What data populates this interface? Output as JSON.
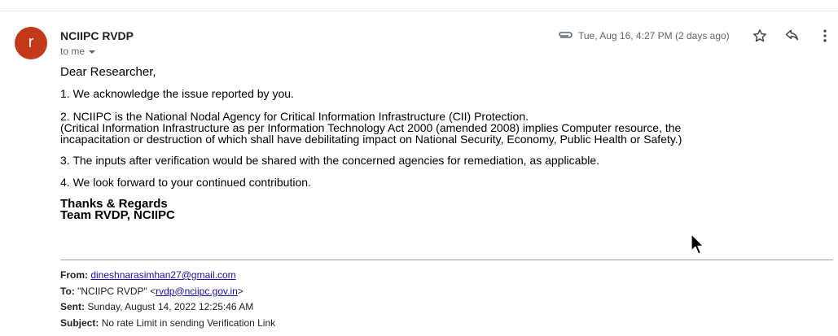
{
  "email": {
    "avatar_letter": "r",
    "avatar_color": "#c5391b",
    "sender": "NCIIPC RVDP",
    "to_me": "to me",
    "date": "Tue, Aug 16, 4:27 PM (2 days ago)",
    "icons": [
      "paperclip-icon",
      "star-icon",
      "reply-icon",
      "more-vert-icon"
    ]
  },
  "body": {
    "greeting": "Dear Researcher,",
    "p1": "1. We acknowledge the issue reported by you.",
    "p2_line1": "2. NCIIPC is the National Nodal Agency for Critical Information Infrastructure (CII) Protection.",
    "p2_line2": "(Critical Information Infrastructure as per Information Technology Act 2000 (amended 2008) implies Computer resource, the",
    "p2_line3": "incapacitation or destruction of which shall have debilitating impact on National Security, Economy, Public Health or Safety.)",
    "p3": "3. The inputs after verification would be shared with the concerned agencies for remediation, as applicable.",
    "p4": "4. We look forward to your continued contribution.",
    "sign1": "Thanks & Regards",
    "sign2": "Team RVDP, NCIIPC"
  },
  "quoted": {
    "from_label": "From:",
    "from_value": "dineshnarasimhan27@gmail.com",
    "to_label": "To:",
    "to_name": "\"NCIIPC RVDP\" <",
    "to_email": "rvdp@nciipc.gov.in",
    "to_end": ">",
    "sent_label": "Sent:",
    "sent_value": "Sunday, August 14, 2022 12:25:46 AM",
    "subject_label": "Subject:",
    "subject_value": "No rate Limit in sending Verification Link"
  }
}
